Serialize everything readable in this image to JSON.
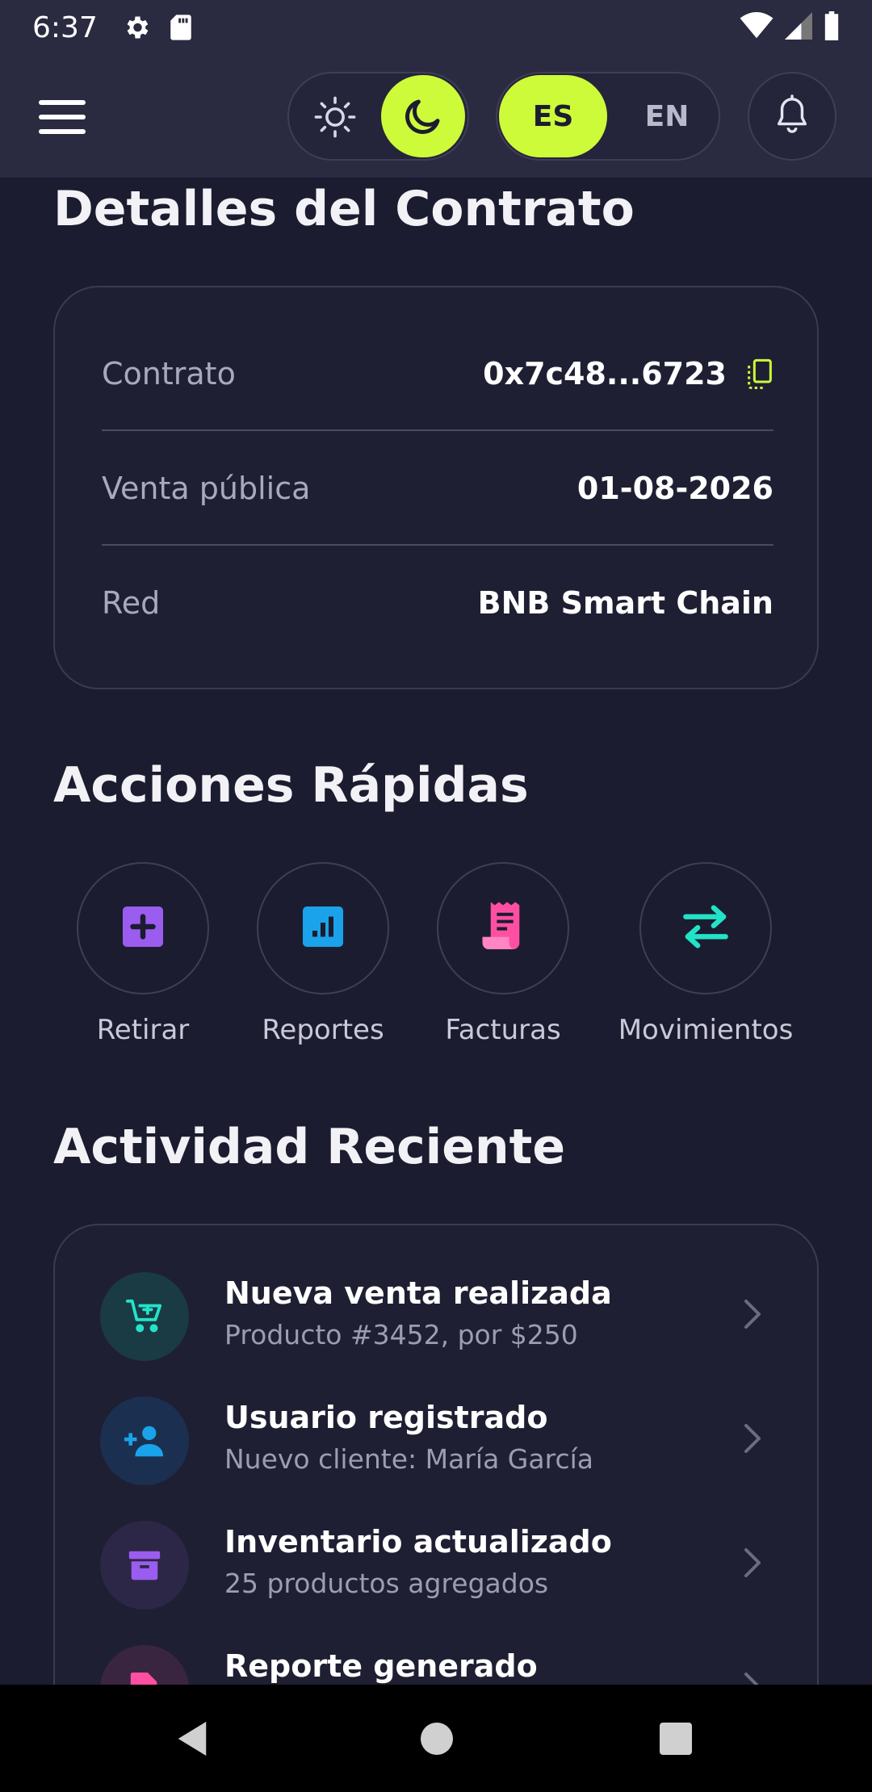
{
  "status_bar": {
    "time": "6:37"
  },
  "app_bar": {
    "lang_es": "ES",
    "lang_en": "EN"
  },
  "contract_details": {
    "title": "Detalles del Contrato",
    "rows": [
      {
        "label": "Contrato",
        "value": "0x7c48...6723"
      },
      {
        "label": "Venta pública",
        "value": "01-08-2026"
      },
      {
        "label": "Red",
        "value": "BNB Smart Chain"
      }
    ]
  },
  "quick_actions": {
    "title": "Acciones Rápidas",
    "items": [
      {
        "label": "Retirar",
        "icon": "plus-square-icon",
        "color": "#9b5cf0"
      },
      {
        "label": "Reportes",
        "icon": "bar-chart-icon",
        "color": "#1aa3ea"
      },
      {
        "label": "Facturas",
        "icon": "receipt-icon",
        "color": "#ff4fa3"
      },
      {
        "label": "Movimientos",
        "icon": "swap-arrows-icon",
        "color": "#22e3c8"
      }
    ]
  },
  "recent_activity": {
    "title": "Actividad Reciente",
    "items": [
      {
        "title": "Nueva venta realizada",
        "subtitle": "Producto #3452, por $250",
        "icon": "cart-add-icon",
        "color": "#22e3c8",
        "bg": "#1a3a44"
      },
      {
        "title": "Usuario registrado",
        "subtitle": "Nuevo cliente: María García",
        "icon": "person-add-icon",
        "color": "#1aa3ea",
        "bg": "#1b3050"
      },
      {
        "title": "Inventario actualizado",
        "subtitle": "25 productos agregados",
        "icon": "archive-box-icon",
        "color": "#9b5cf0",
        "bg": "#2c2746"
      },
      {
        "title": "Reporte generado",
        "subtitle": "",
        "icon": "document-icon",
        "color": "#ff4fa3",
        "bg": "#3a2540"
      }
    ]
  },
  "colors": {
    "accent": "#cdfb3a",
    "background": "#1c1c30",
    "appbar": "#2a2a40"
  }
}
